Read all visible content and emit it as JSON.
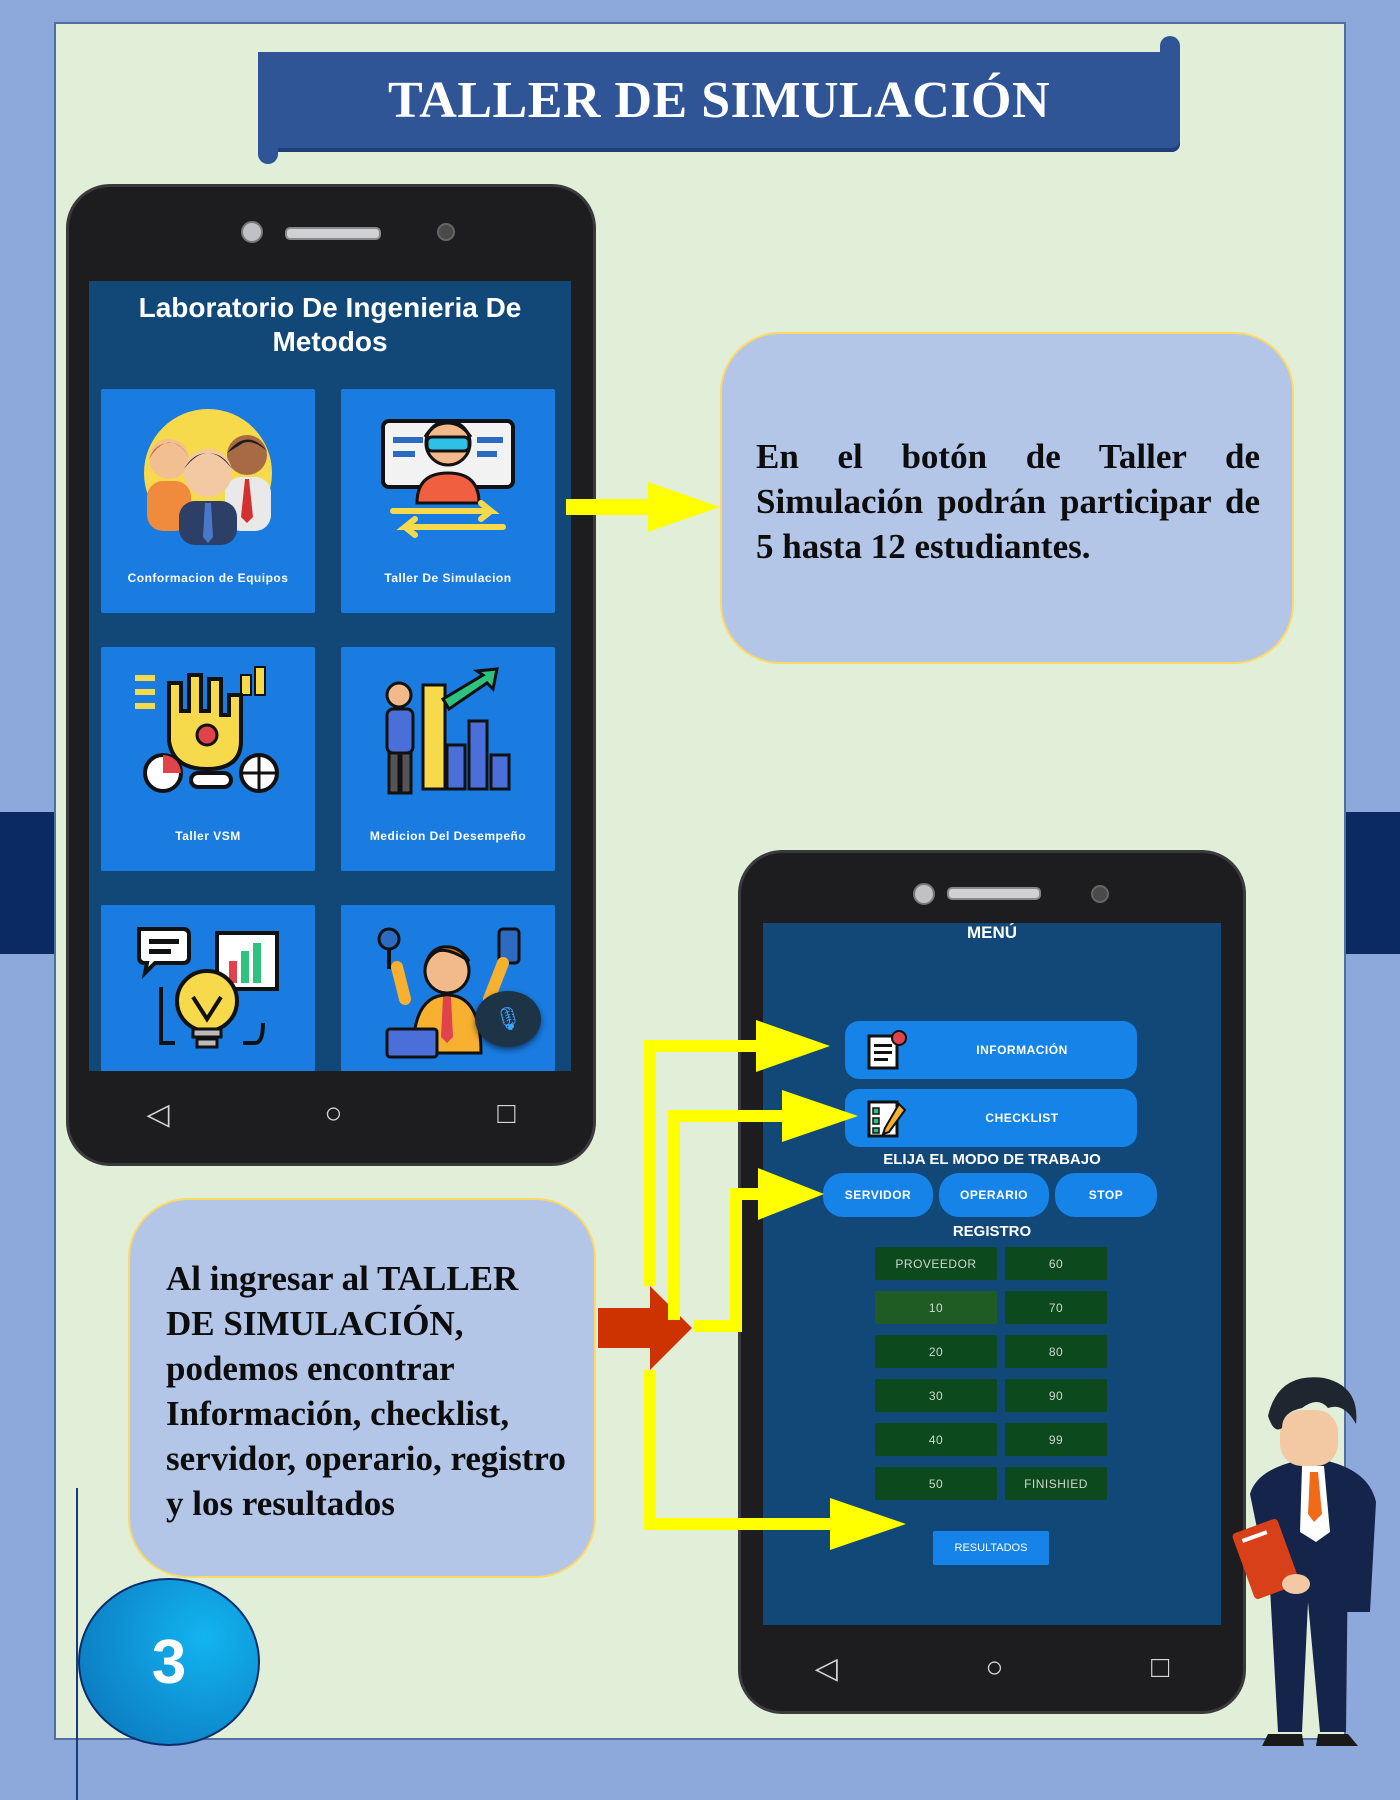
{
  "title": "TALLER DE SIMULACIÓN",
  "phone1": {
    "app_title": "Laboratorio De Ingenieria De Metodos",
    "tiles": [
      {
        "label": "Conformacion de Equipos",
        "icon": "team-icon"
      },
      {
        "label": "Taller De Simulacion",
        "icon": "vr-simulation-icon"
      },
      {
        "label": "Taller VSM",
        "icon": "hand-analytics-icon"
      },
      {
        "label": "Medicion Del Desempeño",
        "icon": "performance-chart-icon"
      },
      {
        "label": "",
        "icon": "idea-bulb-icon"
      },
      {
        "label": "",
        "icon": "worker-laptop-icon"
      }
    ],
    "fab_icon": "microphone-icon"
  },
  "callout1": "En el botón de Taller de Simulación podrán participar de 5 hasta 12 estudiantes.",
  "callout2": "Al ingresar al  TALLER DE SIMULACIÓN, podemos encontrar Información, checklist, servidor, operario, registro y los resultados",
  "phone2": {
    "menu_title": "MENÚ",
    "buttons": {
      "info": "INFORMACIÓN",
      "checklist": "CHECKLIST"
    },
    "mode_label": "ELIJA EL MODO DE TRABAJO",
    "modes": [
      "SERVIDOR",
      "OPERARIO",
      "STOP"
    ],
    "registro_label": "REGISTRO",
    "grid_left": [
      "PROVEEDOR",
      "10",
      "20",
      "30",
      "40",
      "50"
    ],
    "grid_right": [
      "60",
      "70",
      "80",
      "90",
      "99",
      "FINISHIED"
    ],
    "results": "RESULTADOS"
  },
  "page_number": "3",
  "colors": {
    "accent_banner": "#2f5597",
    "callout_fill": "#b4c6e7",
    "arrow": "#ffff00",
    "big_arrow": "#cc3300"
  }
}
